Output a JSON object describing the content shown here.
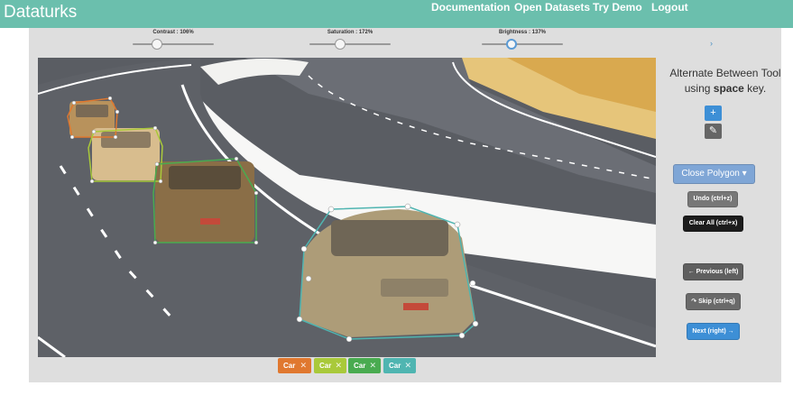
{
  "app": {
    "brand": "Dataturks",
    "nav": [
      "Documentation",
      "Open Datasets",
      "Try Demo",
      "Logout"
    ]
  },
  "sliders": [
    {
      "label": "Contrast : 106%",
      "value_percent": 106,
      "fraction": 0.3
    },
    {
      "label": "Saturation : 172%",
      "value_percent": 172,
      "fraction": 0.38
    },
    {
      "label": "Brightness : 137%",
      "value_percent": 137,
      "fraction": 0.37
    }
  ],
  "sidebar": {
    "hint_line1": "Alternate Between Tool",
    "hint_line2_prefix": "using ",
    "hint_key": "space",
    "hint_line2_suffix": " key.",
    "add_icon": "plus-icon",
    "edit_icon": "pencil-icon",
    "close_polygon": "Close Polygon ▾",
    "undo": "Undo (ctrl+z)",
    "clear_all": "Clear All (ctrl+x)",
    "previous": "← Previous (left)",
    "skip": "↷ Skip (ctrl+q)",
    "next": "Next (right) →"
  },
  "colors": {
    "accent": "#6bbfad",
    "primary_blue": "#3d8fd6",
    "tag_orange": "#e0782f",
    "tag_lime": "#a9c93a",
    "tag_green": "#49ab50",
    "tag_teal": "#4fb5b1"
  },
  "tags": [
    {
      "label": "Car",
      "color": "#e0782f"
    },
    {
      "label": "Car",
      "color": "#a9c93a"
    },
    {
      "label": "Car",
      "color": "#49ab50"
    },
    {
      "label": "Car",
      "color": "#4fb5b1"
    }
  ]
}
